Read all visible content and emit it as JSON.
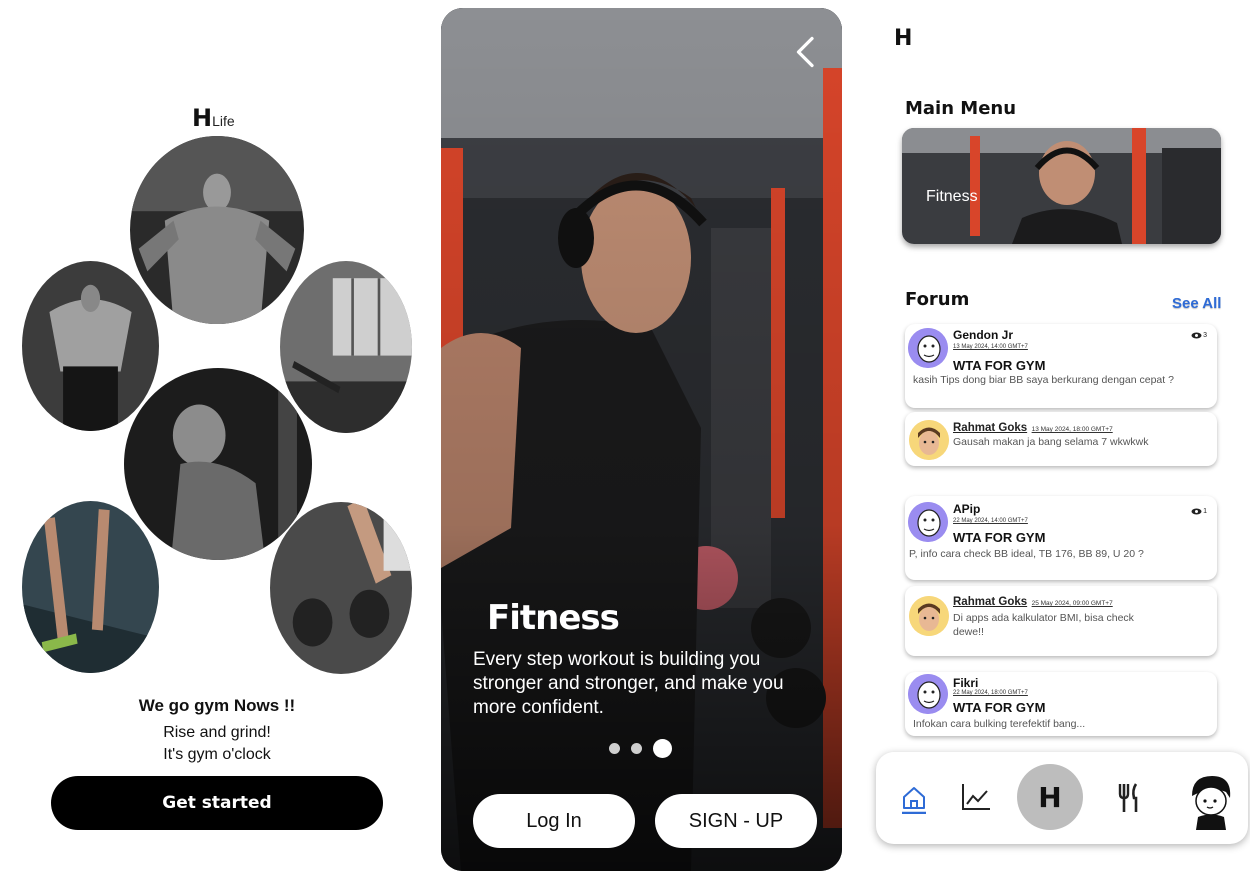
{
  "welcome": {
    "logo_mark": "H",
    "logo_text": "Life",
    "tagline": "We go gym Nows !!",
    "subtitle_line1": "Rise and grind!",
    "subtitle_line2": "It's gym o'clock",
    "cta_label": "Get started"
  },
  "onboarding": {
    "title": "Fitness",
    "description": "Every step workout is building you stronger and stronger, and make you more confident.",
    "pager": {
      "total": 3,
      "active": 3
    },
    "login_label": "Log In",
    "signup_label": "SIGN - UP"
  },
  "home": {
    "logo_mark": "H",
    "main_menu_title": "Main Menu",
    "main_menu_card_label": "Fitness",
    "forum_title": "Forum",
    "see_all_label": "See All",
    "posts": [
      {
        "author": "Gendon Jr",
        "date": "13 May 2024, 14:00 GMT+7",
        "title": "WTA FOR GYM",
        "text": "kasih Tips dong biar BB saya berkurang dengan cepat  ?",
        "views": "3",
        "reply": {
          "author": "Rahmat Goks",
          "date": "13 May 2024, 18:00 GMT+7",
          "text": "Gausah makan ja bang selama 7 wkwkwk"
        }
      },
      {
        "author": "APip",
        "date": "22 May 2024, 14:00 GMT+7",
        "title": "WTA FOR GYM",
        "text": "P, info cara check BB ideal, TB 176, BB 89, U 20 ?",
        "views": "1",
        "reply": {
          "author": "Rahmat Goks",
          "date": "25 May 2024, 09:00 GMT+7",
          "text_line1": "Di apps ada kalkulator BMI, bisa check",
          "text_line2": "dewe!!"
        }
      },
      {
        "author": "Fikri",
        "date": "22 May 2024, 18:00 GMT+7",
        "title": "WTA FOR GYM",
        "text": "Infokan cara bulking terefektif bang..."
      }
    ],
    "nav": {
      "home_icon": "home-icon",
      "stats_icon": "chart-icon",
      "center_mark": "H",
      "food_icon": "fork-knife-icon",
      "profile_icon": "profile-avatar-icon"
    }
  },
  "colors": {
    "accent_blue": "#2e6bd6",
    "avatar_purple": "#9a8cf0",
    "avatar_yellow": "#f7d77a",
    "gym_red": "#d8452a"
  }
}
